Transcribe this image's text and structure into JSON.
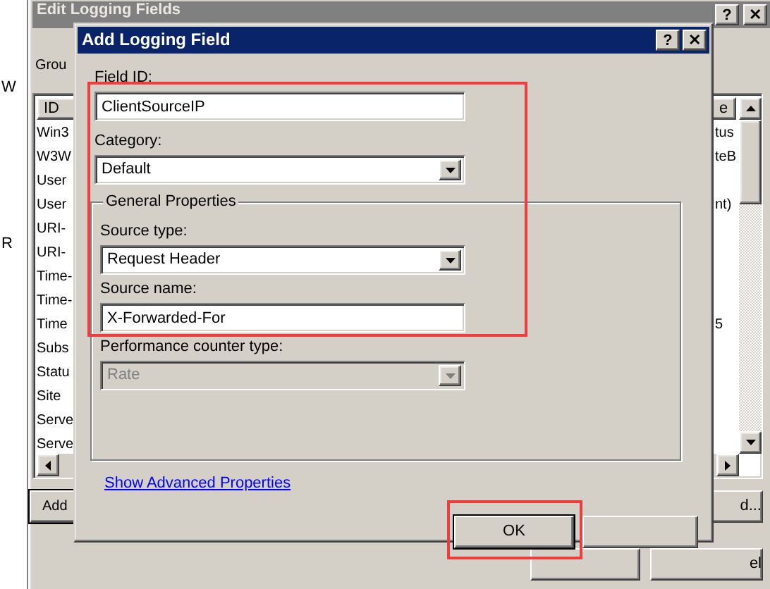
{
  "left_window": {
    "texts": [
      "W",
      "R"
    ]
  },
  "background_window": {
    "title": "Edit Logging Fields",
    "title_buttons": [
      "?",
      "✕"
    ],
    "group_label": "Grou",
    "list": {
      "columns": [
        "ID",
        "e"
      ],
      "rows": [
        {
          "column_1": "Win3",
          "column_2": "tus"
        },
        {
          "column_1": "W3W",
          "column_2": "teB"
        },
        {
          "column_1": "User",
          "column_2": ""
        },
        {
          "column_1": "User",
          "column_2": "nt)"
        },
        {
          "column_1": "URI-",
          "column_2": ""
        },
        {
          "column_1": "URI-",
          "column_2": ""
        },
        {
          "column_1": "Time-",
          "column_2": ""
        },
        {
          "column_1": "Time-",
          "column_2": ""
        },
        {
          "column_1": "Time",
          "column_2": "5"
        },
        {
          "column_1": "Subs",
          "column_2": ""
        },
        {
          "column_1": "Statu",
          "column_2": ""
        },
        {
          "column_1": "Site",
          "column_2": ""
        },
        {
          "column_1": "Serve",
          "column_2": ""
        },
        {
          "column_1": "Serve",
          "column_2": ""
        }
      ]
    },
    "buttons": [
      "Add",
      "d..."
    ],
    "bottom_button": "el"
  },
  "dialog": {
    "title": "Add Logging Field",
    "title_buttons": [
      "?",
      "✕"
    ],
    "fields_highlighted": true,
    "field_id": {
      "label": "Field ID:",
      "value": "ClientSourceIP"
    },
    "category": {
      "label": "Category:",
      "value": "Default"
    },
    "general_properties": {
      "title": "General Properties",
      "fields": [
        {
          "kind": "dropdown",
          "label": "Source type:",
          "value": "Request Header",
          "disabled": false
        },
        {
          "kind": "text",
          "label": "Source name:",
          "value": "X-Forwarded-For",
          "disabled": false
        },
        {
          "kind": "dropdown",
          "label": "Performance counter type:",
          "value": "Rate",
          "disabled": true
        }
      ]
    },
    "link": "Show Advanced Properties",
    "ok_button": {
      "label": "OK",
      "highlighted": true
    }
  }
}
